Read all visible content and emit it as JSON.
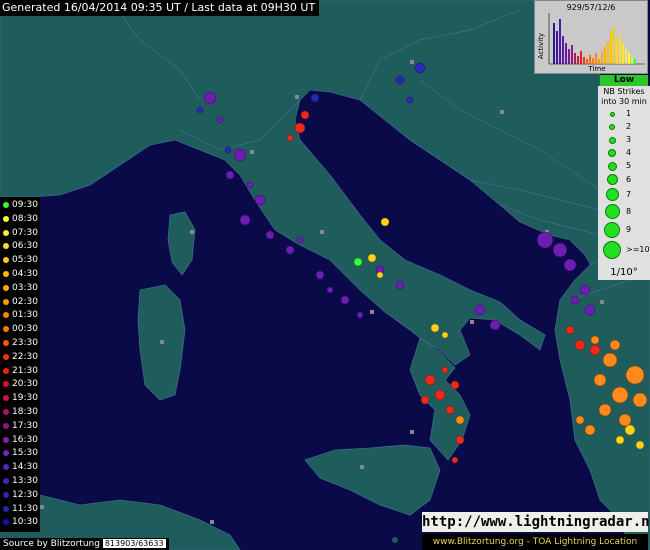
{
  "header": {
    "generated": "Generated 16/04/2014 09:35 UT",
    "last_data": "Last data at 09H30 UT"
  },
  "activity": {
    "label": "929/57/12/6",
    "y_label": "Activity",
    "x_label": "Time"
  },
  "strikes_legend": {
    "level": "Low",
    "title_line1": "NB Strikes",
    "title_line2": "into 30 min",
    "rows": [
      "1",
      "2",
      "3",
      "4",
      "5",
      "6",
      "7",
      "8",
      "9",
      ">=10"
    ],
    "grid": "1/10°"
  },
  "time_legend": [
    "09:30",
    "08:30",
    "07:30",
    "06:30",
    "05:30",
    "04:30",
    "03:30",
    "02:30",
    "01:30",
    "00:30",
    "23:30",
    "22:30",
    "21:30",
    "20:30",
    "19:30",
    "18:30",
    "17:30",
    "16:30",
    "15:30",
    "14:30",
    "13:30",
    "12:30",
    "11:30",
    "10:30"
  ],
  "time_colors": [
    "#33ff33",
    "#ffff33",
    "#ffee33",
    "#ffdd22",
    "#ffcc11",
    "#ffbb00",
    "#ffaa00",
    "#ff9900",
    "#ff8800",
    "#ff7700",
    "#ff5500",
    "#ff3300",
    "#ee2200",
    "#dd1122",
    "#cc1144",
    "#aa1166",
    "#991188",
    "#8822aa",
    "#7722bb",
    "#5522bb",
    "#4422bb",
    "#3322aa",
    "#2222aa",
    "#1111aa"
  ],
  "footer": {
    "source": "Source by Blitzortung",
    "stats": "813903/63633",
    "url": "http://www.lightningradar.net",
    "credit": "www.Blitzortung.org - TOA Lightning Location"
  },
  "colors": {
    "sea": "#0a0a48",
    "land": "#1f5c5c",
    "borders": "#4a6a90"
  }
}
